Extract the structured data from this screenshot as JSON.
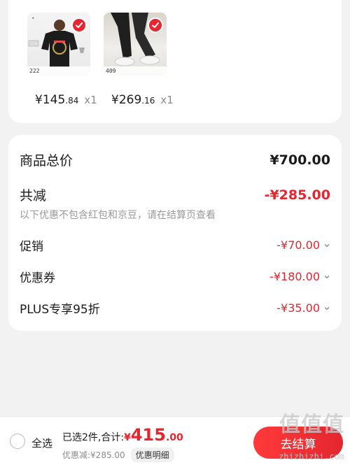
{
  "products": [
    {
      "image": "black-tshirt-photo",
      "tag": "222",
      "price_symbol": "¥",
      "price_int": "145",
      "price_dec": ".84",
      "qty": "x1",
      "selected": true
    },
    {
      "image": "black-pants-white-sneakers-photo",
      "tag": "409",
      "price_symbol": "¥",
      "price_int": "269",
      "price_dec": ".16",
      "qty": "x1",
      "selected": true
    }
  ],
  "summary": {
    "total_label": "商品总价",
    "total_value": "¥700.00",
    "reduction_label": "共减",
    "reduction_value": "-¥285.00",
    "note": "以下优惠不包含红包和京豆，请在结算页查看",
    "items": [
      {
        "label": "促销",
        "value": "-¥70.00"
      },
      {
        "label": "优惠券",
        "value": "-¥180.00"
      },
      {
        "label": "PLUS专享95折",
        "value": "-¥35.00"
      }
    ]
  },
  "bottom": {
    "select_all": "全选",
    "selected_text": "已选2件,合计:",
    "total_symbol": "¥",
    "total_int": "415",
    "total_dec": ".00",
    "discount_text": "优惠减:¥285.00",
    "detail_button": "优惠明细",
    "checkout_button": "去结算"
  },
  "watermark": {
    "text": "值值值",
    "url": "zhizhizhi.com"
  },
  "colors": {
    "accent": "#e3262f",
    "background": "#f2f2f2",
    "muted": "#999999"
  }
}
